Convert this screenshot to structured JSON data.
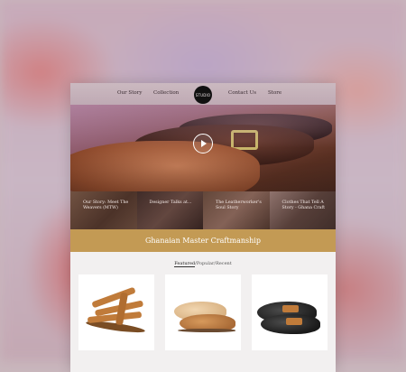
{
  "nav": {
    "items": [
      "Our Story",
      "Collection",
      "Contact Us",
      "Store"
    ],
    "logo_text": "STUDIO"
  },
  "hero": {
    "play_icon": "play-icon"
  },
  "thumbnails": [
    {
      "caption": "Our Story: Meet The Weavers (MTW)"
    },
    {
      "caption": "Designer Talks at..."
    },
    {
      "caption": "The Leatherworker's Soul Story"
    },
    {
      "caption": "Clothes That Tell A Story - Ghana Craft"
    }
  ],
  "banner": {
    "title": "Ghanaian Master Craftmanship"
  },
  "tabs": {
    "featured": "Featured",
    "sep1": " / ",
    "popular": "Popular",
    "sep2": " / ",
    "recent": "Recent"
  },
  "colors": {
    "banner": "#c39a54",
    "nav_bg": "#c4b0b8",
    "page_bg": "#f2f0f0"
  },
  "products": [
    {
      "name": "tan-strap-sandal"
    },
    {
      "name": "two-tone-derby-shoe"
    },
    {
      "name": "black-monk-strap-shoe"
    }
  ]
}
